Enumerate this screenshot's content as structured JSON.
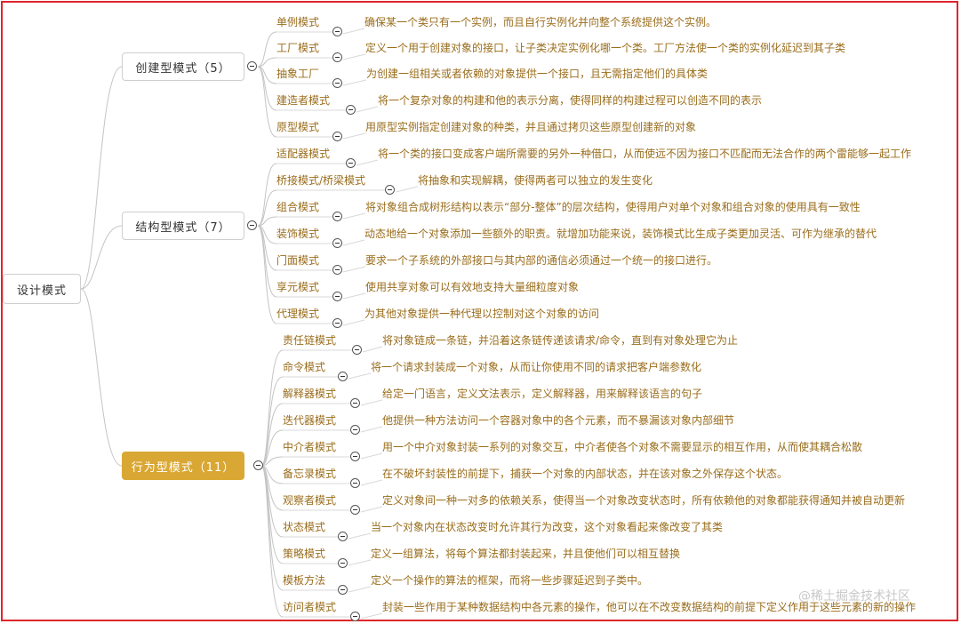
{
  "root": {
    "label": "设计模式"
  },
  "categories": [
    {
      "label": "创建型模式（5）",
      "items": [
        {
          "name": "单例模式",
          "desc": "确保某一个类只有一个实例，而且自行实例化并向整个系统提供这个实例。"
        },
        {
          "name": "工厂模式",
          "desc": "定义一个用于创建对象的接口，让子类决定实例化哪一个类。工厂方法使一个类的实例化延迟到其子类"
        },
        {
          "name": "抽象工厂",
          "desc": "为创建一组相关或者依赖的对象提供一个接口，且无需指定他们的具体类"
        },
        {
          "name": "建造者模式",
          "desc": "将一个复杂对象的构建和他的表示分离，使得同样的构建过程可以创造不同的表示"
        },
        {
          "name": "原型模式",
          "desc": "用原型实例指定创建对象的种类，并且通过拷贝这些原型创建新的对象"
        }
      ]
    },
    {
      "label": "结构型模式（7）",
      "items": [
        {
          "name": "适配器模式",
          "desc": "将一个类的接口变成客户端所需要的另外一种借口，从而使远不因为接口不匹配而无法合作的两个雷能够一起工作"
        },
        {
          "name": "桥接模式/桥梁模式",
          "desc": "将抽象和实现解耦，使得两者可以独立的发生变化"
        },
        {
          "name": "组合模式",
          "desc": "将对象组合成树形结构以表示“部分-整体”的层次结构，使得用户对单个对象和组合对象的使用具有一致性"
        },
        {
          "name": "装饰模式",
          "desc": "动态地给一个对象添加一些额外的职责。就增加功能来说，装饰模式比生成子类更加灵活、可作为继承的替代"
        },
        {
          "name": "门面模式",
          "desc": "要求一个子系统的外部接口与其内部的通信必须通过一个统一的接口进行。"
        },
        {
          "name": "享元模式",
          "desc": "使用共享对象可以有效地支持大量细粒度对象"
        },
        {
          "name": "代理模式",
          "desc": "为其他对象提供一种代理以控制对这个对象的访问"
        }
      ]
    },
    {
      "label": "行为型模式（11）",
      "items": [
        {
          "name": "责任链模式",
          "desc": "将对象链成一条链，并沿着这条链传递该请求/命令，直到有对象处理它为止"
        },
        {
          "name": "命令模式",
          "desc": "将一个请求封装成一个对象，从而让你使用不同的请求把客户端参数化"
        },
        {
          "name": "解释器模式",
          "desc": "给定一门语言，定义文法表示，定义解释器，用来解释该语言的句子"
        },
        {
          "name": "迭代器模式",
          "desc": "他提供一种方法访问一个容器对象中的各个元素，而不暴漏该对象内部细节"
        },
        {
          "name": "中介者模式",
          "desc": "用一个中介对象封装一系列的对象交互，中介者使各个对象不需要显示的相互作用，从而使其耦合松散"
        },
        {
          "name": "备忘录模式",
          "desc": "在不破坏封装性的前提下，捕获一个对象的内部状态，并在该对象之外保存这个状态。"
        },
        {
          "name": "观察者模式",
          "desc": "定义对象间一种一对多的依赖关系，使得当一个对象改变状态时，所有依赖他的对象都能获得通知并被自动更新"
        },
        {
          "name": "状态模式",
          "desc": "当一个对象内在状态改变时允许其行为改变，这个对象看起来像改变了其类"
        },
        {
          "name": "策略模式",
          "desc": "定义一组算法，将每个算法都封装起来，并且使他们可以相互替换"
        },
        {
          "name": "模板方法",
          "desc": "定义一个操作的算法的框架，而将一些步骤延迟到子类中。"
        },
        {
          "name": "访问者模式",
          "desc": "封装一些作用于某种数据结构中各元素的操作，他可以在不改变数据结构的前提下定义作用于这些元素的新的操作"
        }
      ]
    }
  ],
  "watermark": "@稀土掘金技术社区",
  "colors": {
    "accent": "#d9a733",
    "text": "#9a6d1c",
    "frame": "#e0252b"
  }
}
